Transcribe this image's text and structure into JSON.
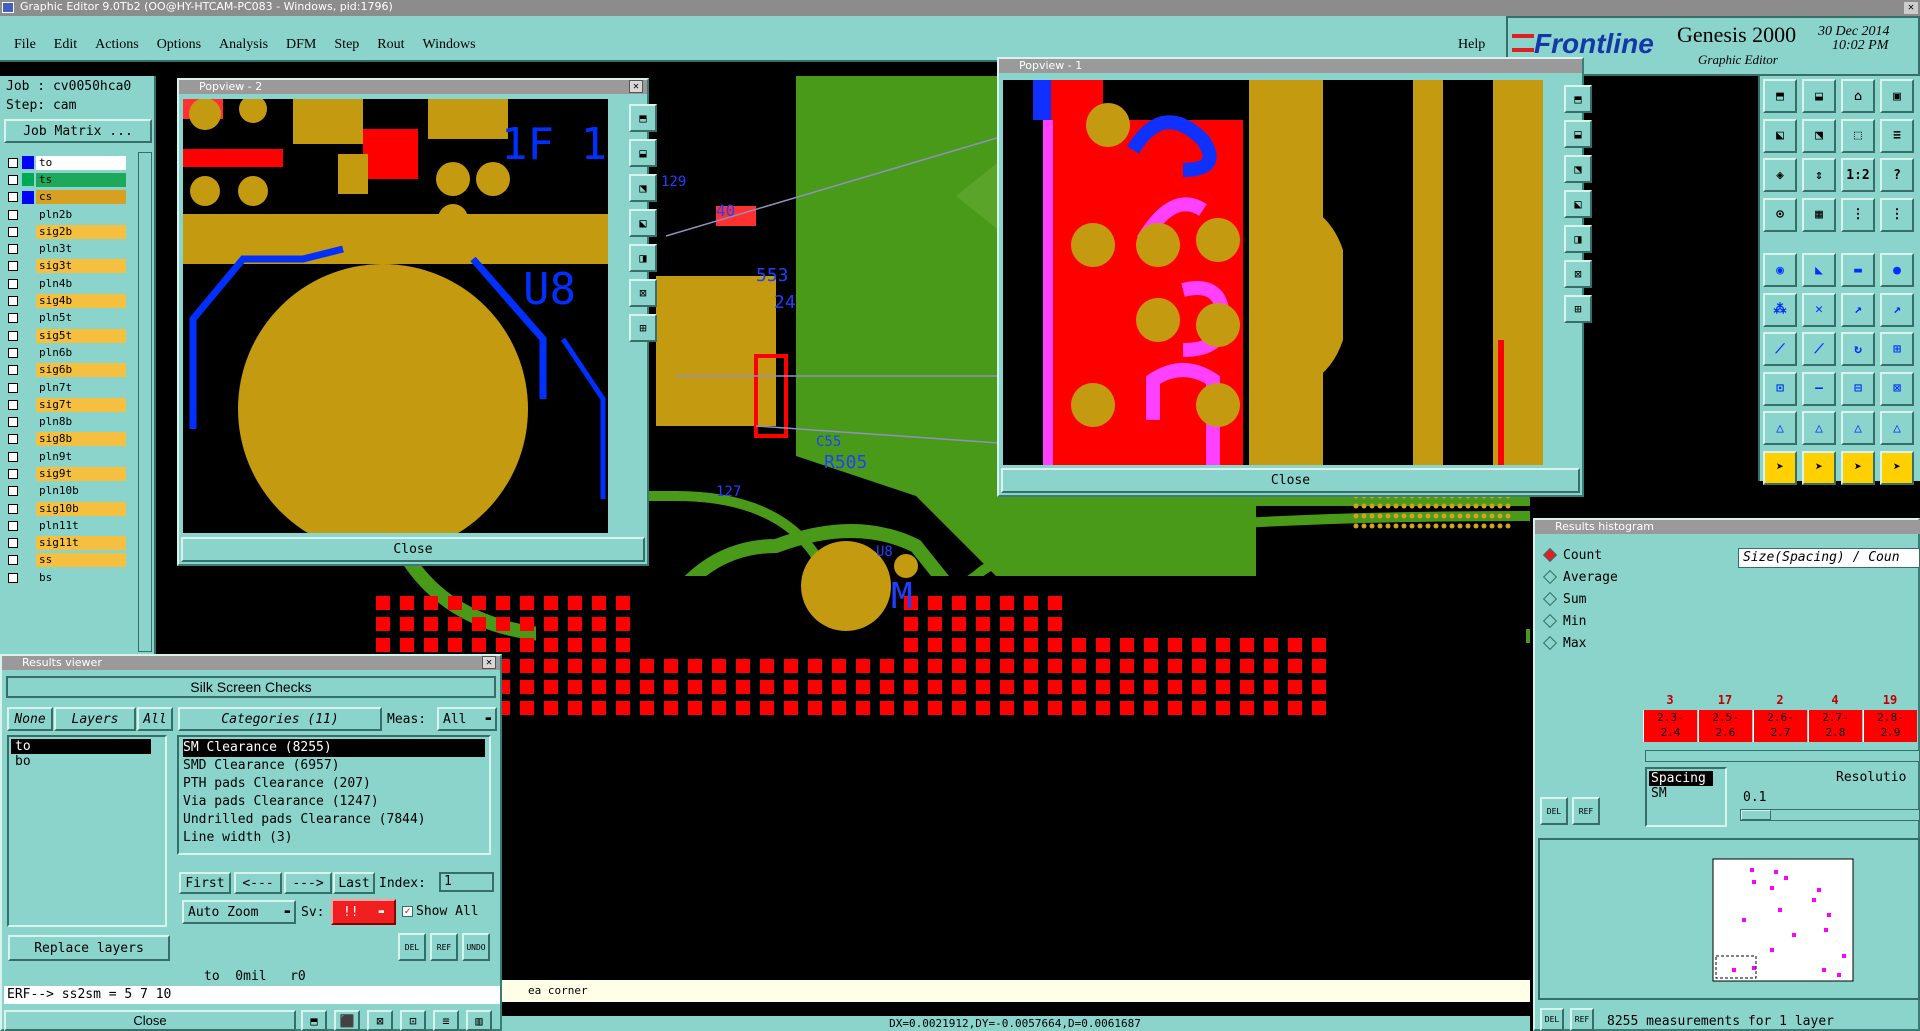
{
  "window_title": "Graphic Editor 9.0Tb2  (OO@HY-HTCAM-PC083 - Windows, pid:1796)",
  "menu": [
    "File",
    "Edit",
    "Actions",
    "Options",
    "Analysis",
    "DFM",
    "Step",
    "Rout",
    "Windows"
  ],
  "help": "Help",
  "brand": {
    "logo": "Frontline",
    "product": "Genesis 2000",
    "subtitle": "Graphic Editor",
    "date": "30 Dec 2014",
    "time": "10:02 PM"
  },
  "job": {
    "job_label": "Job : cv0050hca0",
    "step_label": "Step: cam",
    "matrix_button": "Job Matrix ..."
  },
  "layers": [
    {
      "name": "to",
      "color": "#ffffff",
      "swatch": "#0000ff"
    },
    {
      "name": "ts",
      "color": "#1ea85a",
      "swatch": "#00aa55"
    },
    {
      "name": "cs",
      "color": "#d8a020",
      "swatch": "#0000ff"
    },
    {
      "name": "pln2b",
      "color": "#8ad4cc",
      "swatch": ""
    },
    {
      "name": "sig2b",
      "color": "#f5c040",
      "swatch": ""
    },
    {
      "name": "pln3t",
      "color": "#8ad4cc",
      "swatch": ""
    },
    {
      "name": "sig3t",
      "color": "#f5c040",
      "swatch": ""
    },
    {
      "name": "pln4b",
      "color": "#8ad4cc",
      "swatch": ""
    },
    {
      "name": "sig4b",
      "color": "#f5c040",
      "swatch": ""
    },
    {
      "name": "pln5t",
      "color": "#8ad4cc",
      "swatch": ""
    },
    {
      "name": "sig5t",
      "color": "#f5c040",
      "swatch": ""
    },
    {
      "name": "pln6b",
      "color": "#8ad4cc",
      "swatch": ""
    },
    {
      "name": "sig6b",
      "color": "#f5c040",
      "swatch": ""
    },
    {
      "name": "pln7t",
      "color": "#8ad4cc",
      "swatch": ""
    },
    {
      "name": "sig7t",
      "color": "#f5c040",
      "swatch": ""
    },
    {
      "name": "pln8b",
      "color": "#8ad4cc",
      "swatch": ""
    },
    {
      "name": "sig8b",
      "color": "#f5c040",
      "swatch": ""
    },
    {
      "name": "pln9t",
      "color": "#8ad4cc",
      "swatch": ""
    },
    {
      "name": "sig9t",
      "color": "#f5c040",
      "swatch": ""
    },
    {
      "name": "pln10b",
      "color": "#8ad4cc",
      "swatch": ""
    },
    {
      "name": "sig10b",
      "color": "#f5c040",
      "swatch": ""
    },
    {
      "name": "pln11t",
      "color": "#8ad4cc",
      "swatch": ""
    },
    {
      "name": "sig11t",
      "color": "#f5c040",
      "swatch": ""
    },
    {
      "name": "ss",
      "color": "#f5c040",
      "swatch": ""
    },
    {
      "name": "bs",
      "color": "#8ad4cc",
      "swatch": ""
    }
  ],
  "popview2": {
    "title": "Popview - 2",
    "close": "Close",
    "label_top": "1F 1",
    "label_mid": "U8"
  },
  "popview1": {
    "title": "Popview - 1",
    "close": "Close"
  },
  "board_labels": {
    "r505": "R505",
    "u8": "U8",
    "m": "M",
    "c553": "553",
    "l24": "24",
    "l40": "40",
    "c129": "129",
    "u127": "127",
    "c552": "C55"
  },
  "results_viewer": {
    "title": "Results viewer",
    "header": "Silk Screen Checks",
    "none": "None",
    "layers": "Layers",
    "all": "All",
    "categories_label": "Categories (11)",
    "meas_label": "Meas:",
    "meas_value": "All",
    "layer_items": [
      "to",
      "bo"
    ],
    "categories": [
      "SM Clearance (8255)",
      "SMD Clearance (6957)",
      "PTH pads Clearance (207)",
      "Via pads Clearance (1247)",
      "Undrilled pads Clearance (7844)",
      "Line width (3)"
    ],
    "nav": {
      "first": "First",
      "prev": "<---",
      "next": "--->",
      "last": "Last",
      "index_label": "Index:",
      "index_value": "1"
    },
    "auto_zoom": "Auto Zoom",
    "sv_label": "Sv:",
    "sv_value": "!!",
    "show_all": "Show All",
    "replace_layers": "Replace layers",
    "icon_labels": [
      "DEL",
      "REF",
      "UNDO"
    ],
    "readout": "to  0mil   r0",
    "erf": "ERF--> ss2sm = 5 7 10",
    "close": "Close"
  },
  "status_line": "ea corner",
  "coord_line": "DX=0.0021912,DY=-0.0057664,D=0.0061687",
  "histogram": {
    "title": "Results histogram",
    "modes": [
      "Count",
      "Average",
      "Sum",
      "Min",
      "Max"
    ],
    "header": "Size(Spacing) / Coun",
    "bins": [
      {
        "count": "3",
        "range_top": "2.3-",
        "range_bot": "2.4"
      },
      {
        "count": "17",
        "range_top": "2.5-",
        "range_bot": "2.6"
      },
      {
        "count": "2",
        "range_top": "2.6-",
        "range_bot": "2.7"
      },
      {
        "count": "4",
        "range_top": "2.7-",
        "range_bot": "2.8"
      },
      {
        "count": "19",
        "range_top": "2.8-",
        "range_bot": "2.9"
      }
    ],
    "list_items": [
      "Spacing",
      "SM"
    ],
    "resolution_label": "Resolutio",
    "resolution_value": "0.1",
    "icon_labels": [
      "DEL",
      "REF"
    ],
    "footer": "8255 measurements for 1 layer"
  }
}
